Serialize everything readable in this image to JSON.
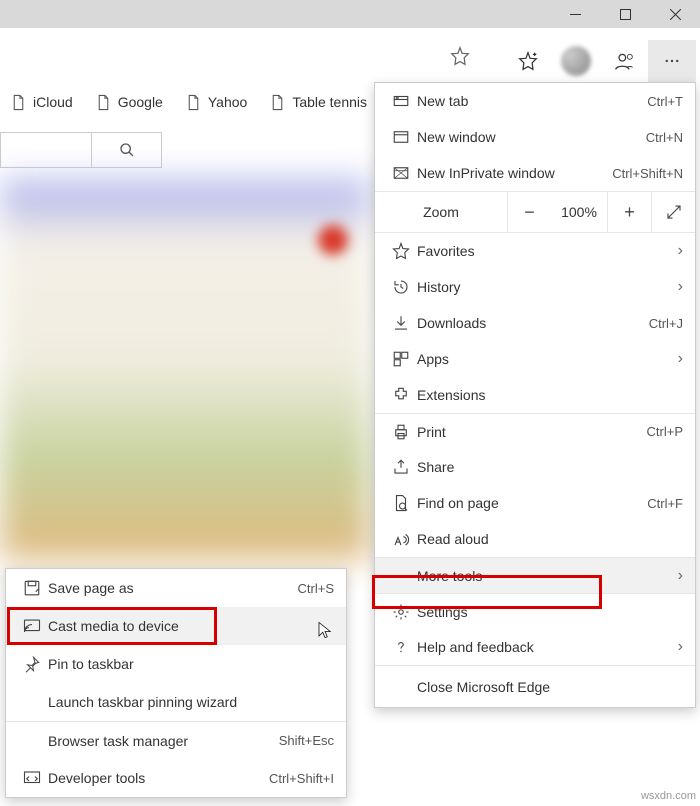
{
  "bookmarks": [
    "iCloud",
    "Google",
    "Yahoo",
    "Table tennis"
  ],
  "sub": {
    "save": "Save page as",
    "save_k": "Ctrl+S",
    "cast": "Cast media to device",
    "pin": "Pin to taskbar",
    "wizard": "Launch taskbar pinning wizard",
    "task": "Browser task manager",
    "task_k": "Shift+Esc",
    "dev": "Developer tools",
    "dev_k": "Ctrl+Shift+I"
  },
  "main": {
    "newtab": "New tab",
    "newtab_k": "Ctrl+T",
    "newwin": "New window",
    "newwin_k": "Ctrl+N",
    "inpriv": "New InPrivate window",
    "inpriv_k": "Ctrl+Shift+N",
    "zoom": "Zoom",
    "zoom_val": "100%",
    "fav": "Favorites",
    "hist": "History",
    "dl": "Downloads",
    "dl_k": "Ctrl+J",
    "apps": "Apps",
    "ext": "Extensions",
    "print": "Print",
    "print_k": "Ctrl+P",
    "share": "Share",
    "find": "Find on page",
    "find_k": "Ctrl+F",
    "read": "Read aloud",
    "more": "More tools",
    "set": "Settings",
    "help": "Help and feedback",
    "close": "Close Microsoft Edge"
  },
  "watermark": "wsxdn.com"
}
